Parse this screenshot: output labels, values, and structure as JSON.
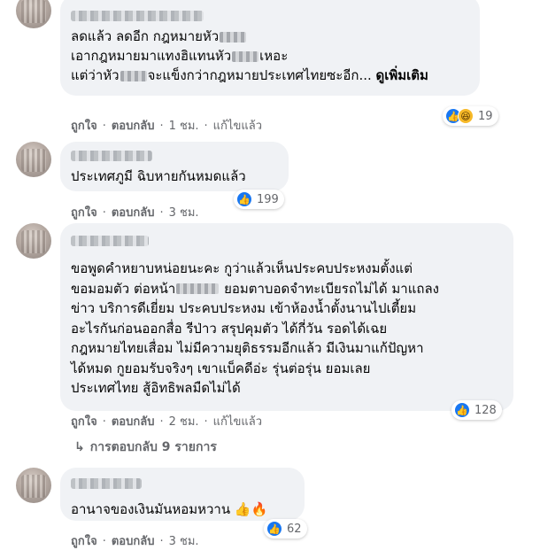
{
  "comments": [
    {
      "lines": [
        "ลดแล้ว ลดอีก กฎหมายหัว",
        "เอากฎหมายมาแทงฮิแทนหัว",
        "แต่ว่าหัว"
      ],
      "line_tails": [
        "",
        "เหอะ",
        "จะแข็งกว่ากฎหมายประเทศไทยซะอีก... "
      ],
      "see_more": "ดูเพิ่มเติม",
      "like": "ถูกใจ",
      "reply": "ตอบกลับ",
      "time": "1 ชม.",
      "edited": "แก้ไขแล้ว",
      "reaction_count": "19"
    },
    {
      "lines": [
        "ประเทศภูมี ฉิบหายกันหมดแล้ว"
      ],
      "like": "ถูกใจ",
      "reply": "ตอบกลับ",
      "time": "3 ชม.",
      "reaction_count": "199"
    },
    {
      "lines": [
        "ขอพูดคำหยาบหน่อยนะคะ กูว่าแล้วเห็นประคบประหงมตั้งแต่",
        "ขอมอมตัว ต่อหน้า",
        "ข่าว บริการดีเยี่ยม ประคบประหงม เข้าห้องน้ำตั้งนานไปเตี้ยม",
        "อะไรกันก่อนออกสื่อ รีป่าว สรุปคุมตัว ได้กี่วัน รอดได้เฉย",
        "กฎหมายไทยเสื่อม ไม่มีความยุติธรรมอีกแล้ว มีเงินมาแก้ปัญหา",
        "ได้หมด กูยอมรับจริงๆ เขาแบ็คดีอ่ะ รุ่นต่อรุ่น ยอมเลย",
        "ประเทศไทย สู้อิทธิพลมืดไม่ได้"
      ],
      "line2_tail": "ยอมตาบอดจำทะเบียรถไม่ได้ มาแถลง",
      "like": "ถูกใจ",
      "reply": "ตอบกลับ",
      "time": "2 ชม.",
      "edited": "แก้ไขแล้ว",
      "reaction_count": "128",
      "replies_label": "การตอบกลับ 9 รายการ"
    },
    {
      "lines": [
        "อานาจของเงินมันหอมหวาน"
      ],
      "like": "ถูกใจ",
      "reply": "ตอบกลับ",
      "time": "3 ชม.",
      "reaction_count": "62"
    }
  ],
  "colors": {
    "bubble": "#f0f2f5",
    "meta": "#65676b",
    "like": "#1877f2"
  },
  "icons": {
    "like": "thumbs-up-icon",
    "haha": "laughing-face-icon",
    "reply_arrow": "reply-arrow-icon"
  }
}
